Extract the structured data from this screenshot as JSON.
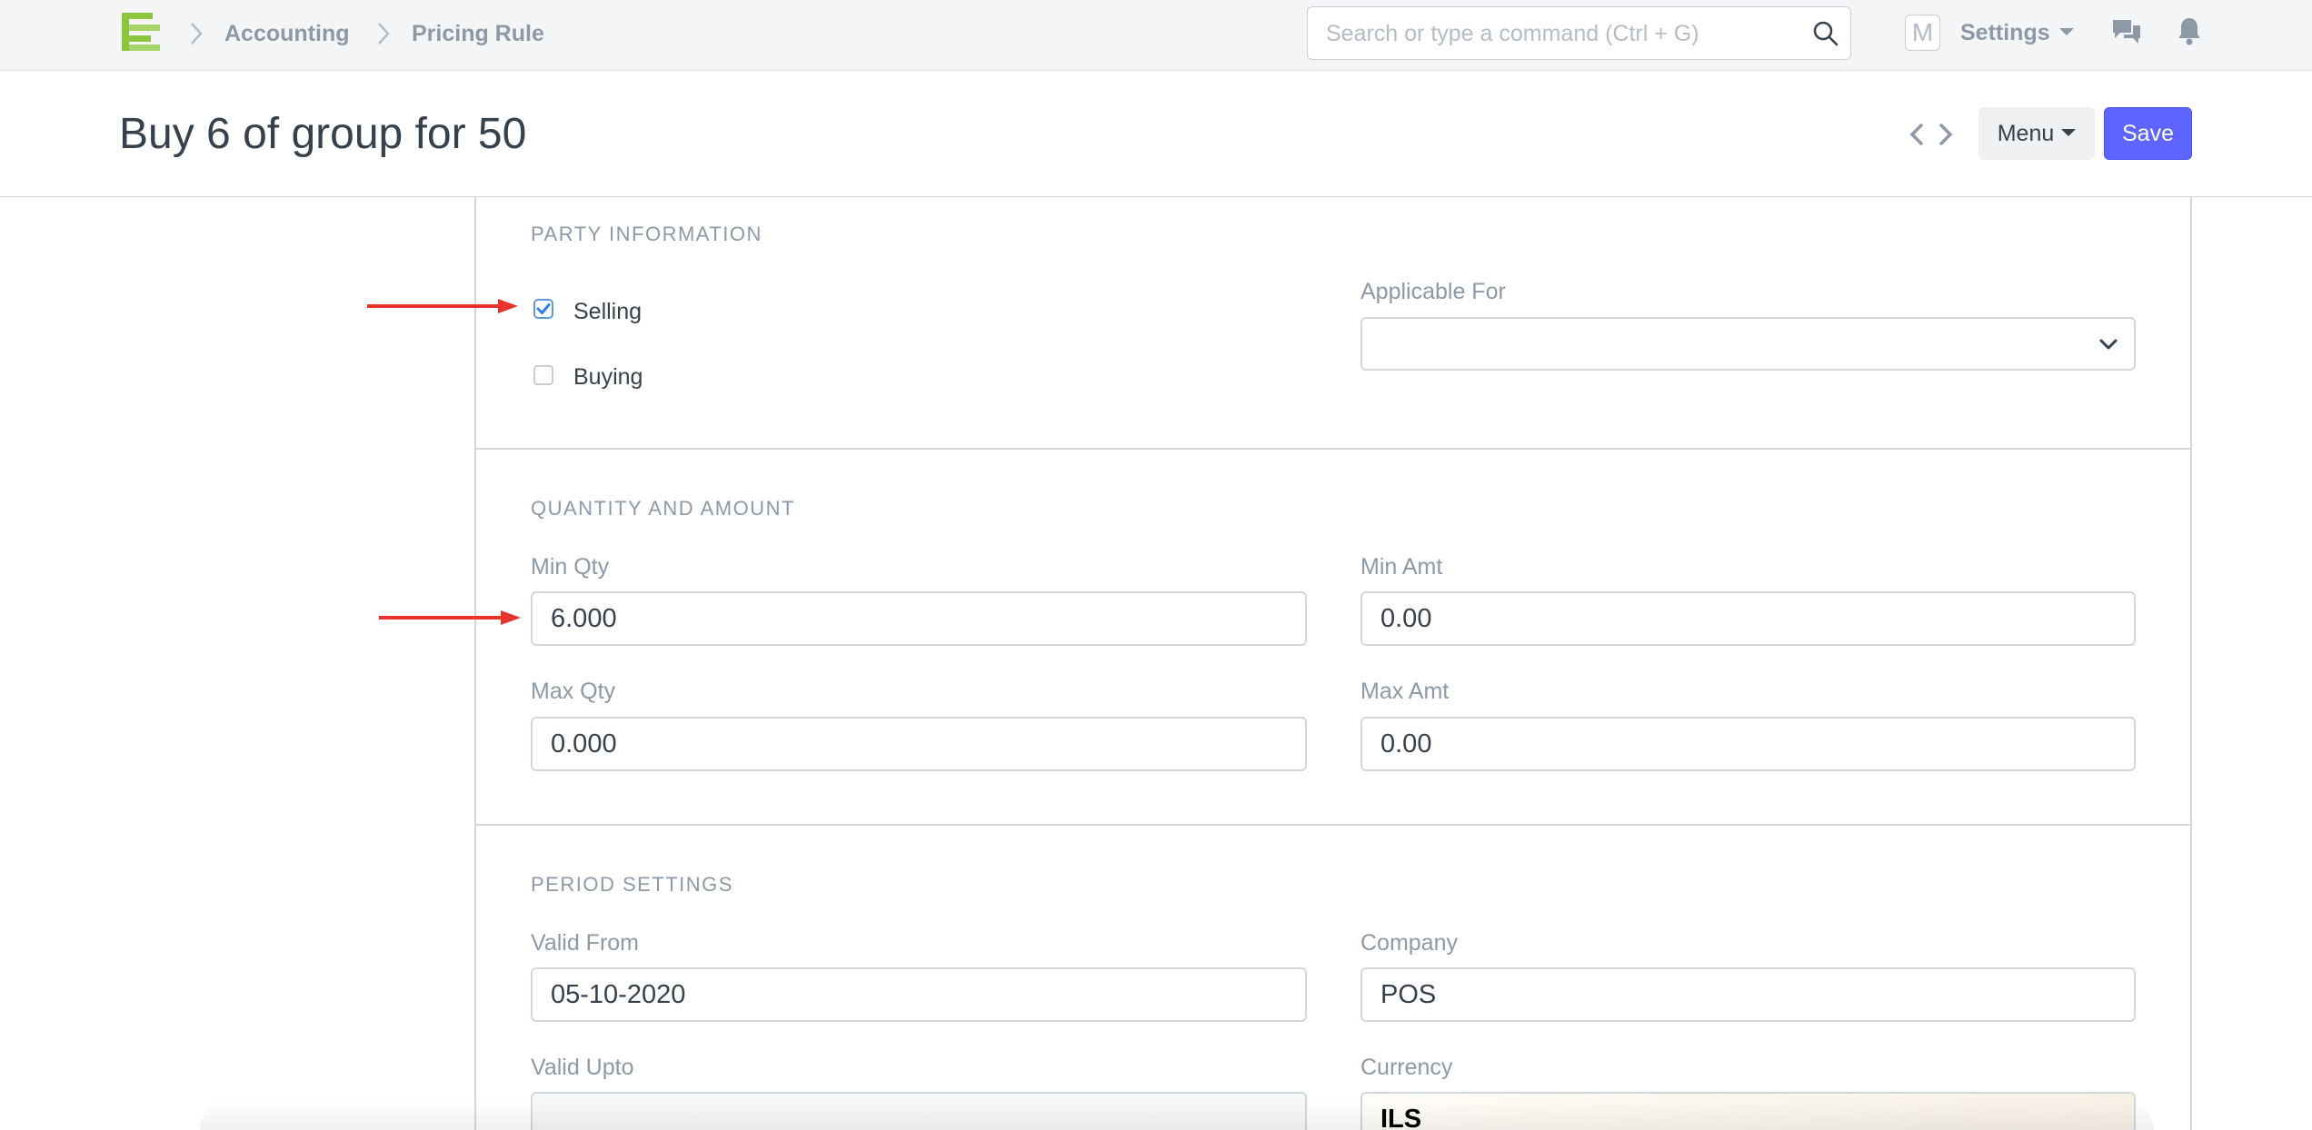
{
  "navbar": {
    "breadcrumbs": [
      "Accounting",
      "Pricing Rule"
    ],
    "search_placeholder": "Search or type a command (Ctrl + G)",
    "avatar_letter": "M",
    "settings_label": "Settings"
  },
  "page": {
    "title": "Buy 6 of group for 50",
    "menu_label": "Menu",
    "save_label": "Save"
  },
  "sections": {
    "party": {
      "heading": "PARTY INFORMATION",
      "selling_label": "Selling",
      "selling_checked": true,
      "buying_label": "Buying",
      "buying_checked": false,
      "applicable_for_label": "Applicable For",
      "applicable_for_value": ""
    },
    "quantity": {
      "heading": "QUANTITY AND AMOUNT",
      "min_qty_label": "Min Qty",
      "min_qty_value": "6.000",
      "min_amt_label": "Min Amt",
      "min_amt_value": "0.00",
      "max_qty_label": "Max Qty",
      "max_qty_value": "0.000",
      "max_amt_label": "Max Amt",
      "max_amt_value": "0.00"
    },
    "period": {
      "heading": "PERIOD SETTINGS",
      "valid_from_label": "Valid From",
      "valid_from_value": "05-10-2020",
      "company_label": "Company",
      "company_value": "POS",
      "valid_upto_label": "Valid Upto",
      "valid_upto_value": "",
      "currency_label": "Currency",
      "currency_value": "ILS"
    }
  },
  "colors": {
    "primary": "#5e64ff",
    "annotation_arrow": "#e8332a",
    "logo_green": "#8cc63f",
    "checkbox_blue": "#2f80ed"
  }
}
